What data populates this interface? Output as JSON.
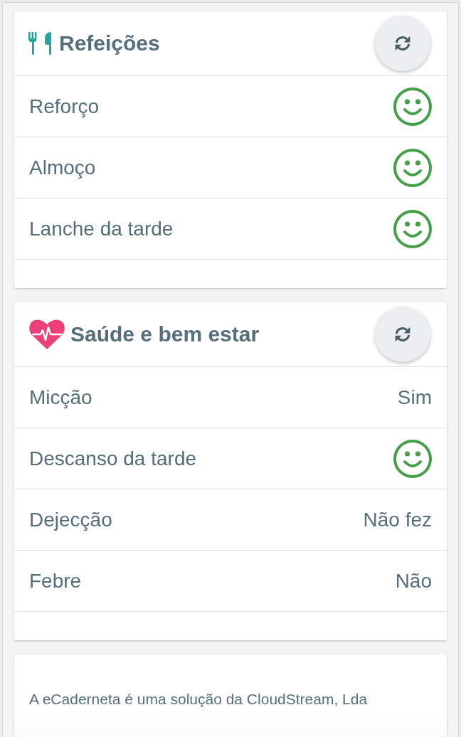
{
  "sections": [
    {
      "title": "Refeições",
      "kind": "meals",
      "items": [
        {
          "label": "Reforço",
          "kind": "smiley"
        },
        {
          "label": "Almoço",
          "kind": "smiley"
        },
        {
          "label": "Lanche da tarde",
          "kind": "smiley"
        }
      ]
    },
    {
      "title": "Saúde e bem estar",
      "kind": "health",
      "items": [
        {
          "label": "Micção",
          "kind": "text",
          "value": "Sim"
        },
        {
          "label": "Descanso da tarde",
          "kind": "smiley"
        },
        {
          "label": "Dejecção",
          "kind": "text",
          "value": "Não fez"
        },
        {
          "label": "Febre",
          "kind": "text",
          "value": "Não"
        }
      ]
    }
  ],
  "footer": {
    "text": "A eCaderneta é uma solução da CloudStream, Lda"
  }
}
